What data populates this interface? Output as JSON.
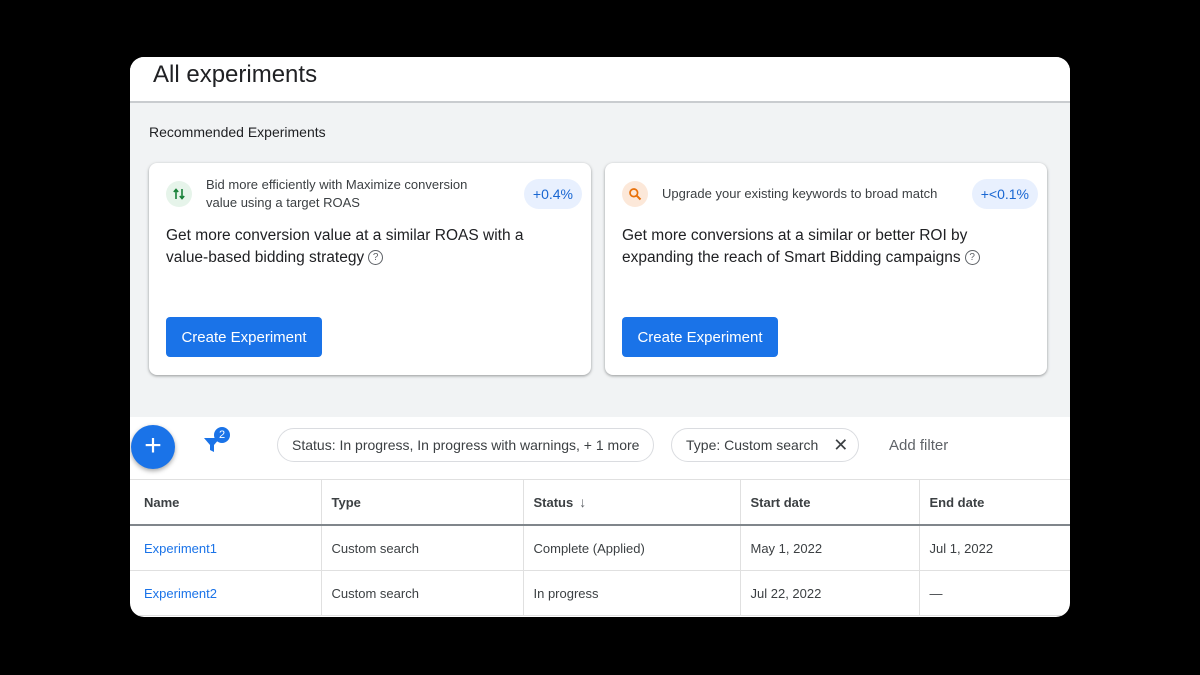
{
  "header": {
    "title": "All experiments"
  },
  "recommended": {
    "title": "Recommended Experiments",
    "cards": [
      {
        "icon": "bidding-arrows-icon",
        "headline": "Bid more efficiently with Maximize conversion value using a target ROAS",
        "uplift": "+0.4%",
        "body": "Get more conversion value at a similar ROAS with a value-based bidding strategy",
        "button": "Create Experiment"
      },
      {
        "icon": "search-icon",
        "headline": "Upgrade your existing keywords to broad match",
        "uplift": "+<0.1%",
        "body": "Get more conversions at a similar or better ROI by expanding the reach of Smart Bidding campaigns",
        "button": "Create Experiment"
      }
    ]
  },
  "toolbar": {
    "add_icon": "+",
    "filter_count": "2",
    "filter_chips": [
      {
        "label": "Status: In progress, In progress with warnings, + 1 more"
      },
      {
        "label": "Type: Custom search",
        "close": "✕"
      }
    ],
    "add_filter": "Add filter"
  },
  "table": {
    "columns": [
      "Name",
      "Type",
      "Status",
      "Start date",
      "End date"
    ],
    "sort_indicator": "↓",
    "rows": [
      {
        "name": "Experiment1",
        "type": "Custom search",
        "status": "Complete (Applied)",
        "start": "May 1, 2022",
        "end": "Jul 1, 2022"
      },
      {
        "name": "Experiment2",
        "type": "Custom search",
        "status": "In progress",
        "start": "Jul 22, 2022",
        "end": "—"
      }
    ]
  },
  "colors": {
    "accent": "#1a73e8",
    "background": "#000000",
    "panel": "#f1f3f4"
  }
}
